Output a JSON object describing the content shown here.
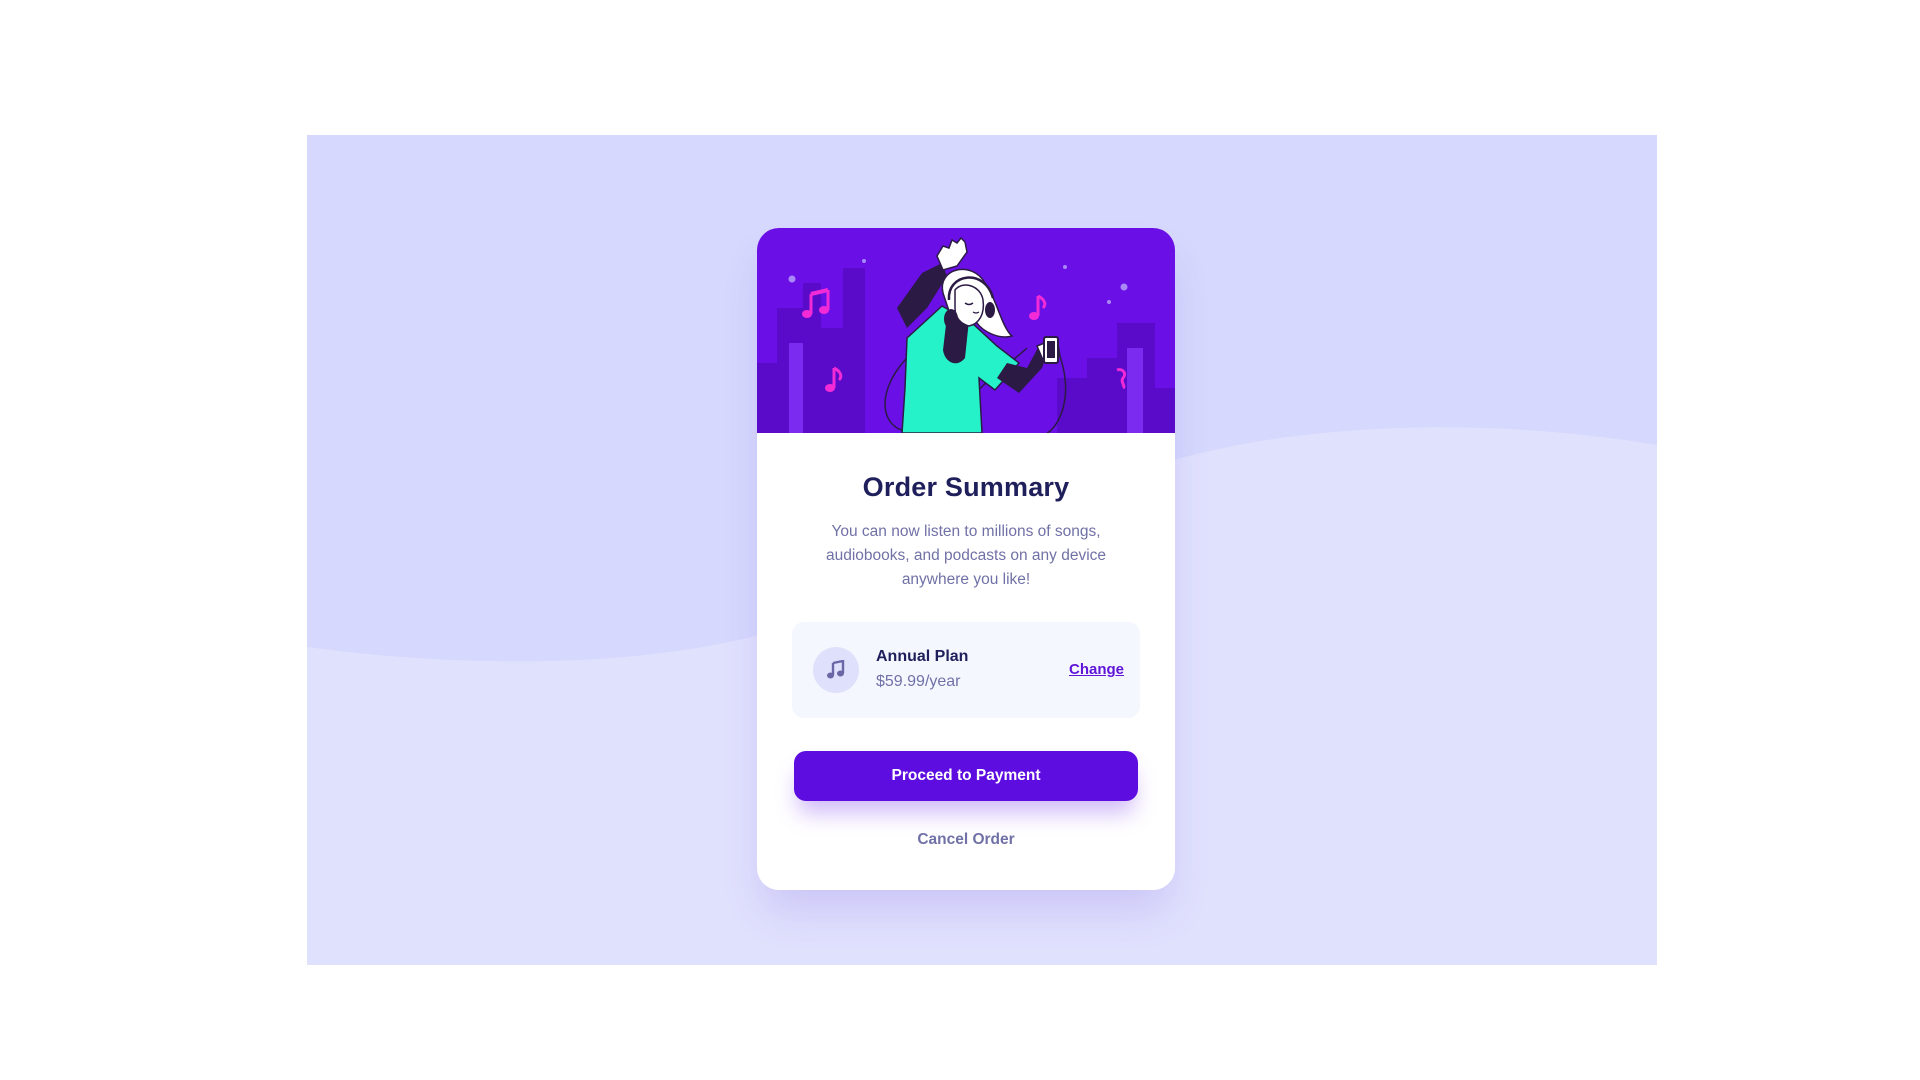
{
  "colors": {
    "page_bg": "#ffffff",
    "stage_bg": "#e0e1fd",
    "wave_top": "#d6d8fd",
    "hero_bg": "#6a10e6",
    "accent": "#5e0de0",
    "title_color": "#1f1f5b",
    "muted_text": "#7071a6",
    "plan_bg": "#f5f7ff"
  },
  "card": {
    "hero_image": "music-listener-illustration",
    "title": "Order Summary",
    "description": "You can now listen to millions of songs, audiobooks, and podcasts on any device anywhere you like!",
    "plan": {
      "icon": "music-note-icon",
      "name": "Annual Plan",
      "price": "$59.99/year",
      "change_label": "Change"
    },
    "pay_label": "Proceed to Payment",
    "cancel_label": "Cancel Order"
  }
}
